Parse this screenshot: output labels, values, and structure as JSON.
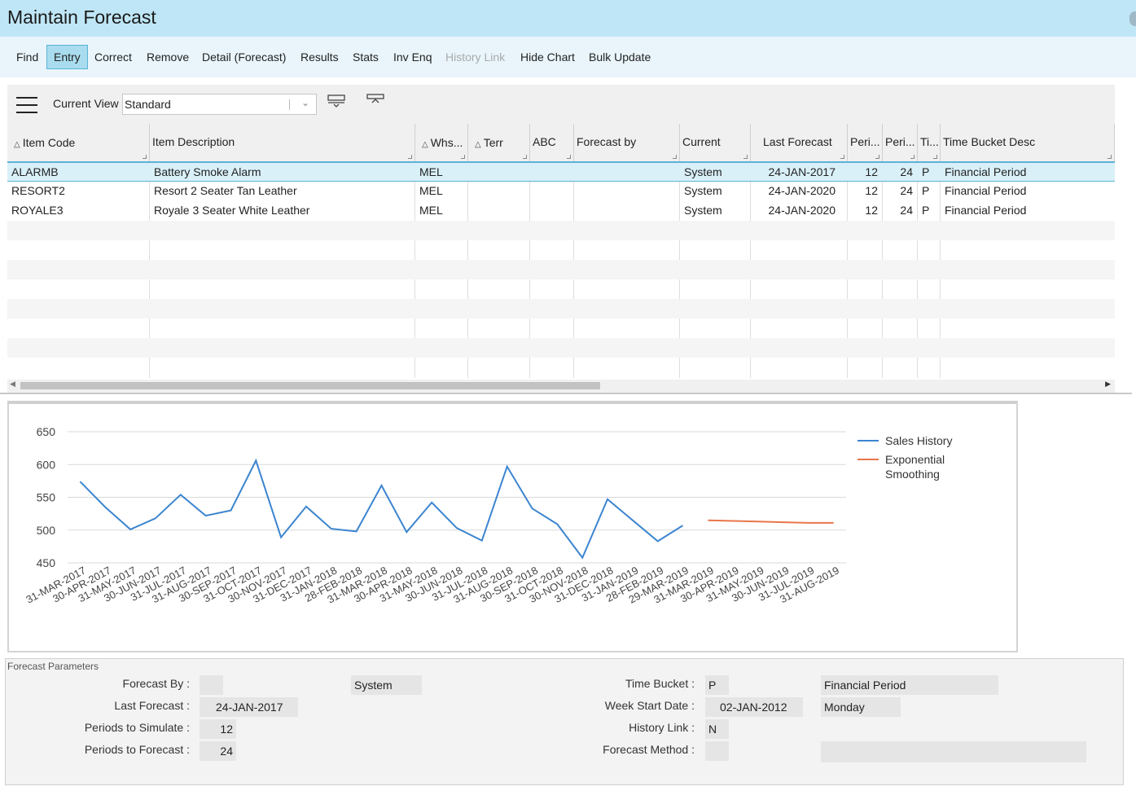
{
  "window": {
    "title": "Maintain Forecast"
  },
  "toolbar": {
    "find": "Find",
    "entry": "Entry",
    "correct": "Correct",
    "remove": "Remove",
    "detail": "Detail (Forecast)",
    "results": "Results",
    "stats": "Stats",
    "inv_enq": "Inv Enq",
    "history_link": "History Link",
    "hide_chart": "Hide Chart",
    "bulk_update": "Bulk Update"
  },
  "view": {
    "label": "Current View",
    "value": "Standard"
  },
  "grid": {
    "columns": {
      "item_code": "Item Code",
      "item_desc": "Item Description",
      "whs": "Whs...",
      "terr": "Terr",
      "abc": "ABC",
      "forecast_by": "Forecast by",
      "current": "Current",
      "last_forecast": "Last Forecast",
      "peri1": "Peri...",
      "peri2": "Peri...",
      "ti": "Ti...",
      "time_bucket_desc": "Time Bucket Desc"
    },
    "rows": [
      {
        "code": "ALARMB",
        "desc": "Battery Smoke Alarm",
        "whs": "MEL",
        "current": "System",
        "last": "24-JAN-2017",
        "p1": "12",
        "p2": "24",
        "ti": "P",
        "tbd": "Financial Period"
      },
      {
        "code": "RESORT2",
        "desc": "Resort 2 Seater Tan Leather",
        "whs": "MEL",
        "current": "System",
        "last": "24-JAN-2020",
        "p1": "12",
        "p2": "24",
        "ti": "P",
        "tbd": "Financial Period"
      },
      {
        "code": "ROYALE3",
        "desc": "Royale 3 Seater White Leather",
        "whs": "MEL",
        "current": "System",
        "last": "24-JAN-2020",
        "p1": "12",
        "p2": "24",
        "ti": "P",
        "tbd": "Financial Period"
      }
    ]
  },
  "chart_data": {
    "type": "line",
    "title": "",
    "ylim": [
      450,
      650
    ],
    "yticks": [
      650,
      600,
      550,
      500,
      450
    ],
    "categories": [
      "31-MAR-2017",
      "30-APR-2017",
      "31-MAY-2017",
      "30-JUN-2017",
      "31-JUL-2017",
      "31-AUG-2017",
      "30-SEP-2017",
      "31-OCT-2017",
      "30-NOV-2017",
      "31-DEC-2017",
      "31-JAN-2018",
      "28-FEB-2018",
      "31-MAR-2018",
      "30-APR-2018",
      "31-MAY-2018",
      "30-JUN-2018",
      "31-JUL-2018",
      "31-AUG-2018",
      "30-SEP-2018",
      "31-OCT-2018",
      "30-NOV-2018",
      "31-DEC-2018",
      "31-JAN-2019",
      "28-FEB-2019",
      "29-MAR-2019",
      "31-MAR-2019",
      "30-APR-2019",
      "31-MAY-2019",
      "30-JUN-2019",
      "31-JUL-2019",
      "31-AUG-2019"
    ],
    "series": [
      {
        "name": "Sales History",
        "color": "#3c85d0",
        "start": 0,
        "values": [
          574,
          535,
          501,
          518,
          554,
          522,
          530,
          606,
          489,
          536,
          502,
          498,
          568,
          497,
          542,
          503,
          484,
          597,
          533,
          509,
          458,
          547,
          515,
          483,
          507
        ]
      },
      {
        "name": "Exponential Smoothing",
        "color": "#e8764a",
        "start": 25,
        "values": [
          515,
          514,
          513,
          512,
          511,
          511
        ]
      }
    ],
    "legend": "right",
    "grid": true
  },
  "params": {
    "section_title": "Forecast Parameters",
    "forecast_by_label": "Forecast By :",
    "forecast_by_value": "",
    "forecast_by_desc": "System",
    "last_forecast_label": "Last Forecast :",
    "last_forecast_value": "24-JAN-2017",
    "periods_sim_label": "Periods to Simulate :",
    "periods_sim_value": "12",
    "periods_fc_label": "Periods to Forecast :",
    "periods_fc_value": "24",
    "time_bucket_label": "Time Bucket :",
    "time_bucket_value": "P",
    "time_bucket_desc": "Financial Period",
    "week_start_label": "Week Start Date :",
    "week_start_value": "02-JAN-2012",
    "week_start_day": "Monday",
    "history_link_label": "History Link :",
    "history_link_value": "N",
    "forecast_method_label": "Forecast Method :",
    "forecast_method_value": "",
    "forecast_method_desc": ""
  }
}
